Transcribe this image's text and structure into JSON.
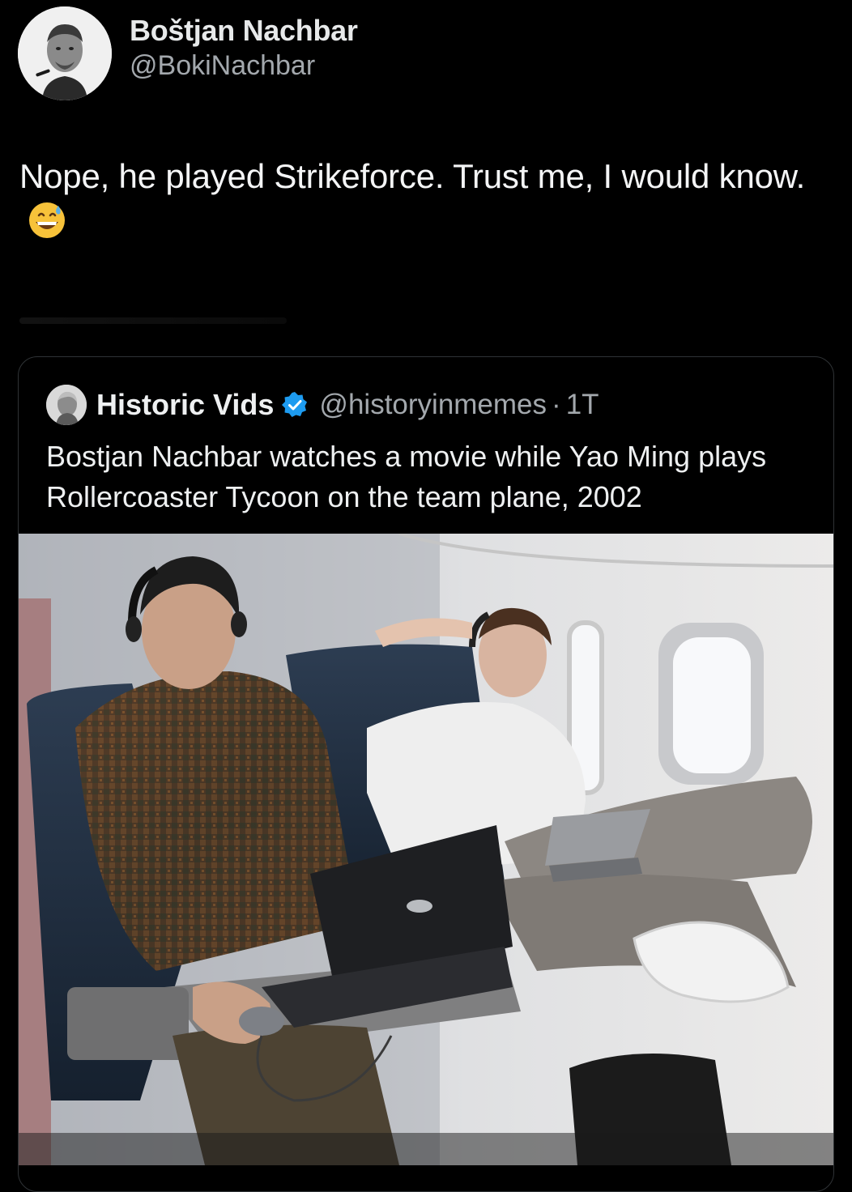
{
  "post": {
    "author_name": "Boštjan Nachbar",
    "author_handle": "@BokiNachbar",
    "text": "Nope, he played Strikeforce. Trust me, I would know.",
    "emoji": "grinning-face-with-sweat-icon"
  },
  "quoted_post": {
    "author_name": "Historic Vids",
    "verified": true,
    "author_handle": "@historyinmemes",
    "separator": "·",
    "time": "1T",
    "text": "Bostjan Nachbar watches a movie while Yao Ming plays Rollercoaster Tycoon on the team plane, 2002",
    "media": "photo-two-players-on-airplane"
  },
  "colors": {
    "background": "#000000",
    "text_primary": "#e7e9ea",
    "text_secondary": "#a3a8ad",
    "border": "#2f3336",
    "verified_blue": "#1d9bf0"
  }
}
